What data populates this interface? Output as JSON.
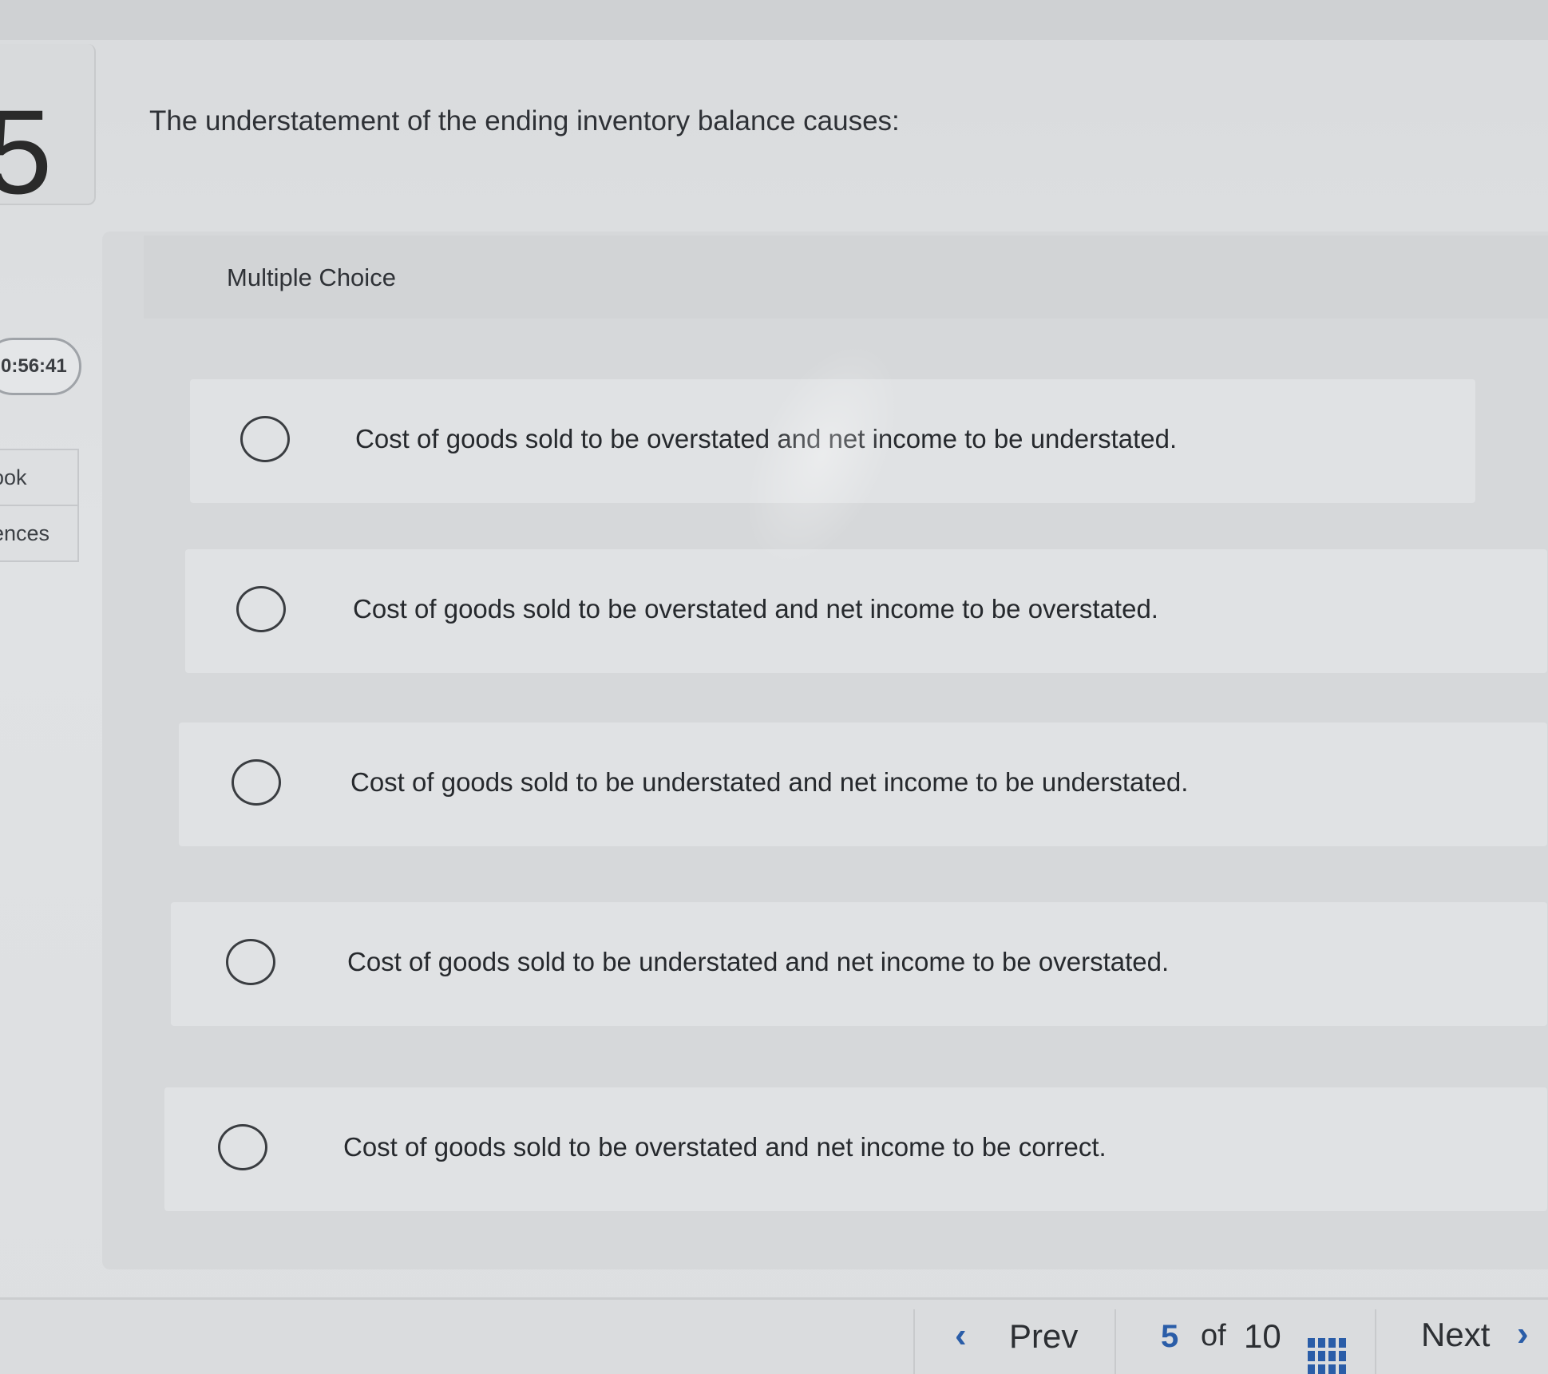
{
  "question_number": "5",
  "question_text": "The understatement of the ending inventory balance causes:",
  "timer": "0:56:41",
  "side_tabs": [
    "ook",
    "ences"
  ],
  "section_label": "Multiple Choice",
  "options": [
    {
      "text": "Cost of goods sold to be overstated and net income to be understated.",
      "selected": false
    },
    {
      "text": "Cost of goods sold to be overstated and net income to be overstated.",
      "selected": false
    },
    {
      "text": "Cost of goods sold to be understated and net income to be understated.",
      "selected": false
    },
    {
      "text": "Cost of goods sold to be understated and net income to be overstated.",
      "selected": false
    },
    {
      "text": "Cost of goods sold to be overstated and net income to be correct.",
      "selected": false
    }
  ],
  "navigation": {
    "prev_label": "Prev",
    "current_page": "5",
    "of_label": "of",
    "total_pages": "10",
    "next_label": "Next",
    "prev_icon": "chevron-left-icon",
    "next_icon": "chevron-right-icon",
    "grid_icon": "question-grid-icon"
  },
  "colors": {
    "accent": "#2a5da8"
  }
}
